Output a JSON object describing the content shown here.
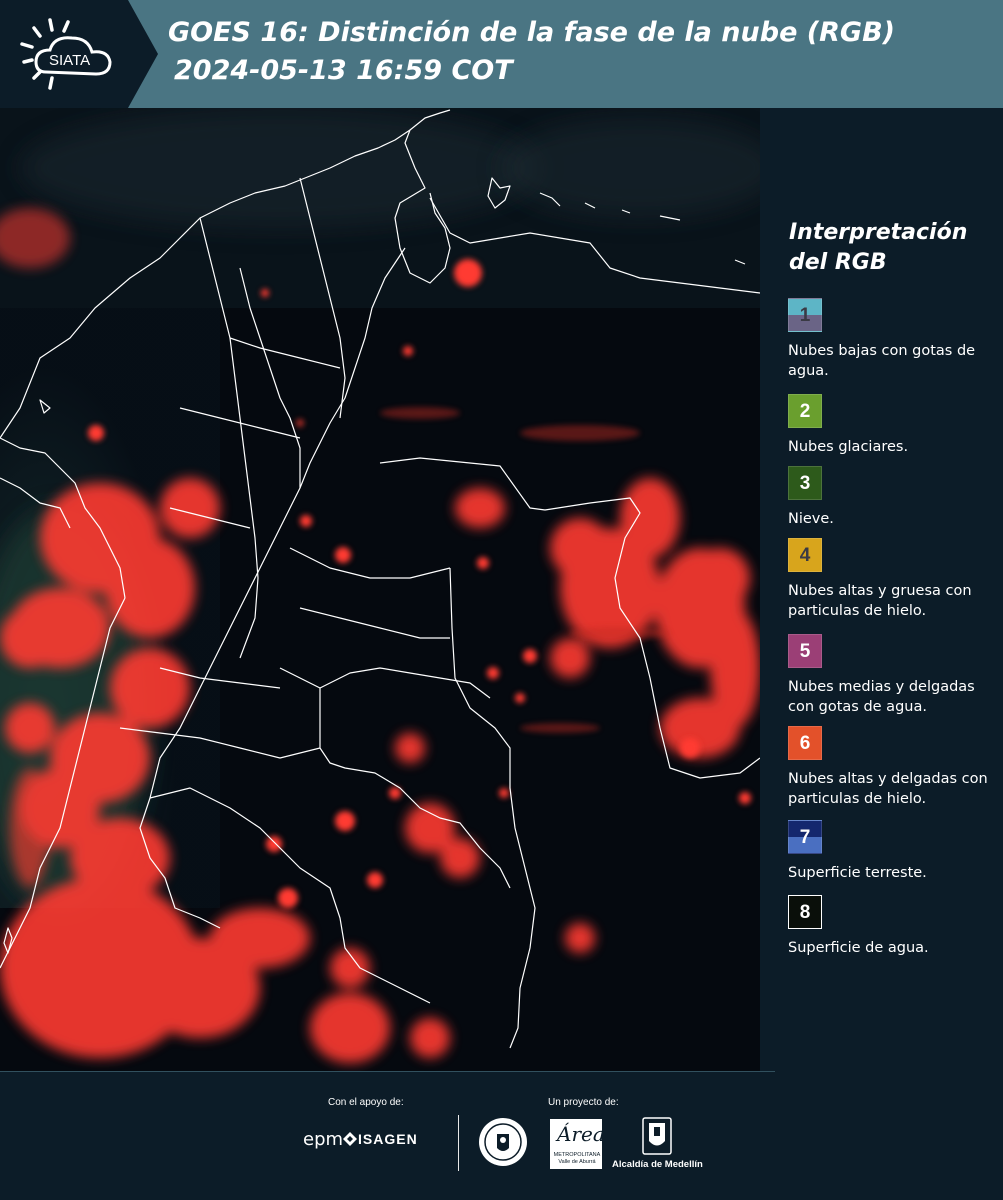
{
  "header": {
    "logo_text": "SIATA",
    "title_line1": "GOES 16: Distinción de la fase de la nube (RGB)",
    "title_line2": "2024-05-13 16:59 COT",
    "background": "#4a7583"
  },
  "legend": {
    "title": "Interpretación del RGB",
    "items": [
      {
        "num": "1",
        "label": "Nubes bajas con gotas de agua.",
        "color_top": "#5db5c6",
        "color_bottom": "#6a6486",
        "num_color": "#3a3a44"
      },
      {
        "num": "2",
        "label": "Nubes glaciares.",
        "color_top": "#6a9f2e",
        "color_bottom": "#6a9f2e",
        "num_color": "#ffffff"
      },
      {
        "num": "3",
        "label": "Nieve.",
        "color_top": "#2d5a1b",
        "color_bottom": "#2d5a1b",
        "num_color": "#ffffff"
      },
      {
        "num": "4",
        "label": "Nubes altas y gruesa con particulas de hielo.",
        "color_top": "#d8a51c",
        "color_bottom": "#d8a51c",
        "num_color": "#3a3a44"
      },
      {
        "num": "5",
        "label": "Nubes medias y delgadas con gotas de agua.",
        "color_top": "#9b3f76",
        "color_bottom": "#9b3f76",
        "num_color": "#ffffff"
      },
      {
        "num": "6",
        "label": "Nubes altas y delgadas con particulas de hielo.",
        "color_top": "#e3512a",
        "color_bottom": "#e3512a",
        "num_color": "#ffffff"
      },
      {
        "num": "7",
        "label": "Superficie terreste.",
        "color_top": "#14276e",
        "color_bottom": "#4a6fc1",
        "num_color": "#ffffff"
      },
      {
        "num": "8",
        "label": "Superficie de agua.",
        "color_top": "#0a0f0a",
        "color_bottom": "#0a0f0a",
        "num_color": "#ffffff"
      }
    ]
  },
  "footer": {
    "support_label": "Con el apoyo de:",
    "project_label": "Un proyecto de:",
    "sponsor1": "epm",
    "sponsor2": "ISAGEN",
    "partner_area": "Área",
    "partner_area_sub": "METROPOLITANA Valle de Aburrá",
    "partner_alcaldia": "Alcaldía de Medellín"
  },
  "colors": {
    "map_bg": "#05090f",
    "cloud_ice": "#ff3b30",
    "border_line": "#ffffff",
    "panel_bg": "#0c1c28"
  }
}
